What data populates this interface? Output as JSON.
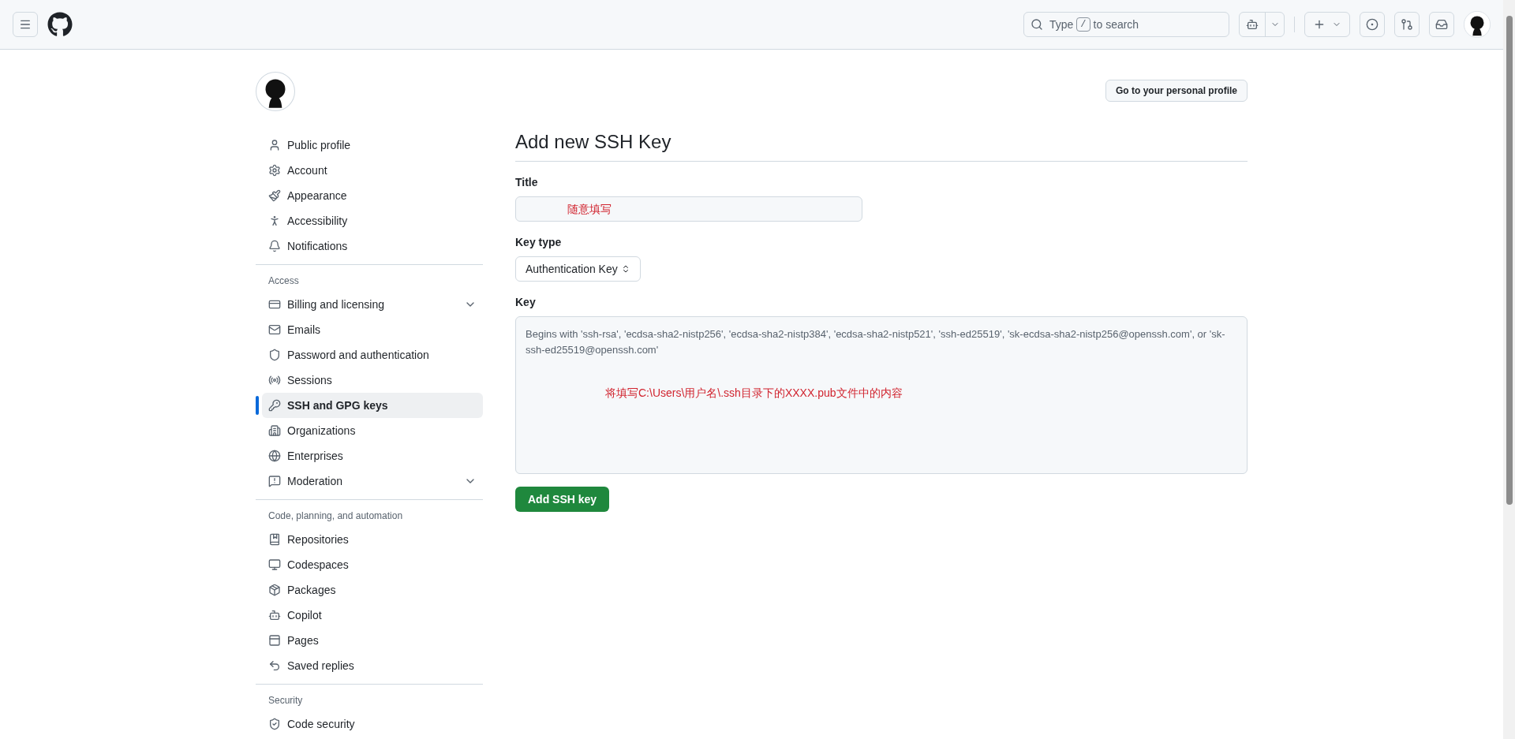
{
  "header": {
    "search": {
      "before": "Type",
      "key": "/",
      "after": "to search"
    }
  },
  "profile_button": "Go to your personal profile",
  "sidebar": {
    "sections": [
      {
        "items": [
          {
            "label": "Public profile",
            "kind": "link",
            "selected": false
          },
          {
            "label": "Account",
            "kind": "link",
            "selected": false
          },
          {
            "label": "Appearance",
            "kind": "link",
            "selected": false
          },
          {
            "label": "Accessibility",
            "kind": "link",
            "selected": false
          },
          {
            "label": "Notifications",
            "kind": "link",
            "selected": false
          }
        ]
      },
      {
        "heading": "Access",
        "items": [
          {
            "label": "Billing and licensing",
            "kind": "group",
            "expanded": false,
            "selected": false
          },
          {
            "label": "Emails",
            "kind": "link",
            "selected": false
          },
          {
            "label": "Password and authentication",
            "kind": "link",
            "selected": false
          },
          {
            "label": "Sessions",
            "kind": "link",
            "selected": false
          },
          {
            "label": "SSH and GPG keys",
            "kind": "link",
            "selected": true
          },
          {
            "label": "Organizations",
            "kind": "link",
            "selected": false
          },
          {
            "label": "Enterprises",
            "kind": "link",
            "selected": false
          },
          {
            "label": "Moderation",
            "kind": "group",
            "expanded": false,
            "selected": false
          }
        ]
      },
      {
        "heading": "Code, planning, and automation",
        "items": [
          {
            "label": "Repositories",
            "kind": "link",
            "selected": false
          },
          {
            "label": "Codespaces",
            "kind": "link",
            "selected": false
          },
          {
            "label": "Packages",
            "kind": "link",
            "selected": false
          },
          {
            "label": "Copilot",
            "kind": "link",
            "selected": false
          },
          {
            "label": "Pages",
            "kind": "link",
            "selected": false
          },
          {
            "label": "Saved replies",
            "kind": "link",
            "selected": false
          }
        ]
      },
      {
        "heading": "Security",
        "items": [
          {
            "label": "Code security",
            "kind": "link",
            "selected": false
          }
        ]
      }
    ]
  },
  "form": {
    "heading": "Add new SSH Key",
    "title_label": "Title",
    "title_annotation": "随意填写",
    "key_type_label": "Key type",
    "key_type_value": "Authentication Key",
    "key_label": "Key",
    "key_placeholder": "Begins with 'ssh-rsa', 'ecdsa-sha2-nistp256', 'ecdsa-sha2-nistp384', 'ecdsa-sha2-nistp521', 'ssh-ed25519', 'sk-ecdsa-sha2-nistp256@openssh.com', or 'sk-ssh-ed25519@openssh.com'",
    "key_annotation": "将填写C:\\Users\\用户名\\.ssh目录下的XXXX.pub文件中的内容",
    "submit": "Add SSH key"
  }
}
